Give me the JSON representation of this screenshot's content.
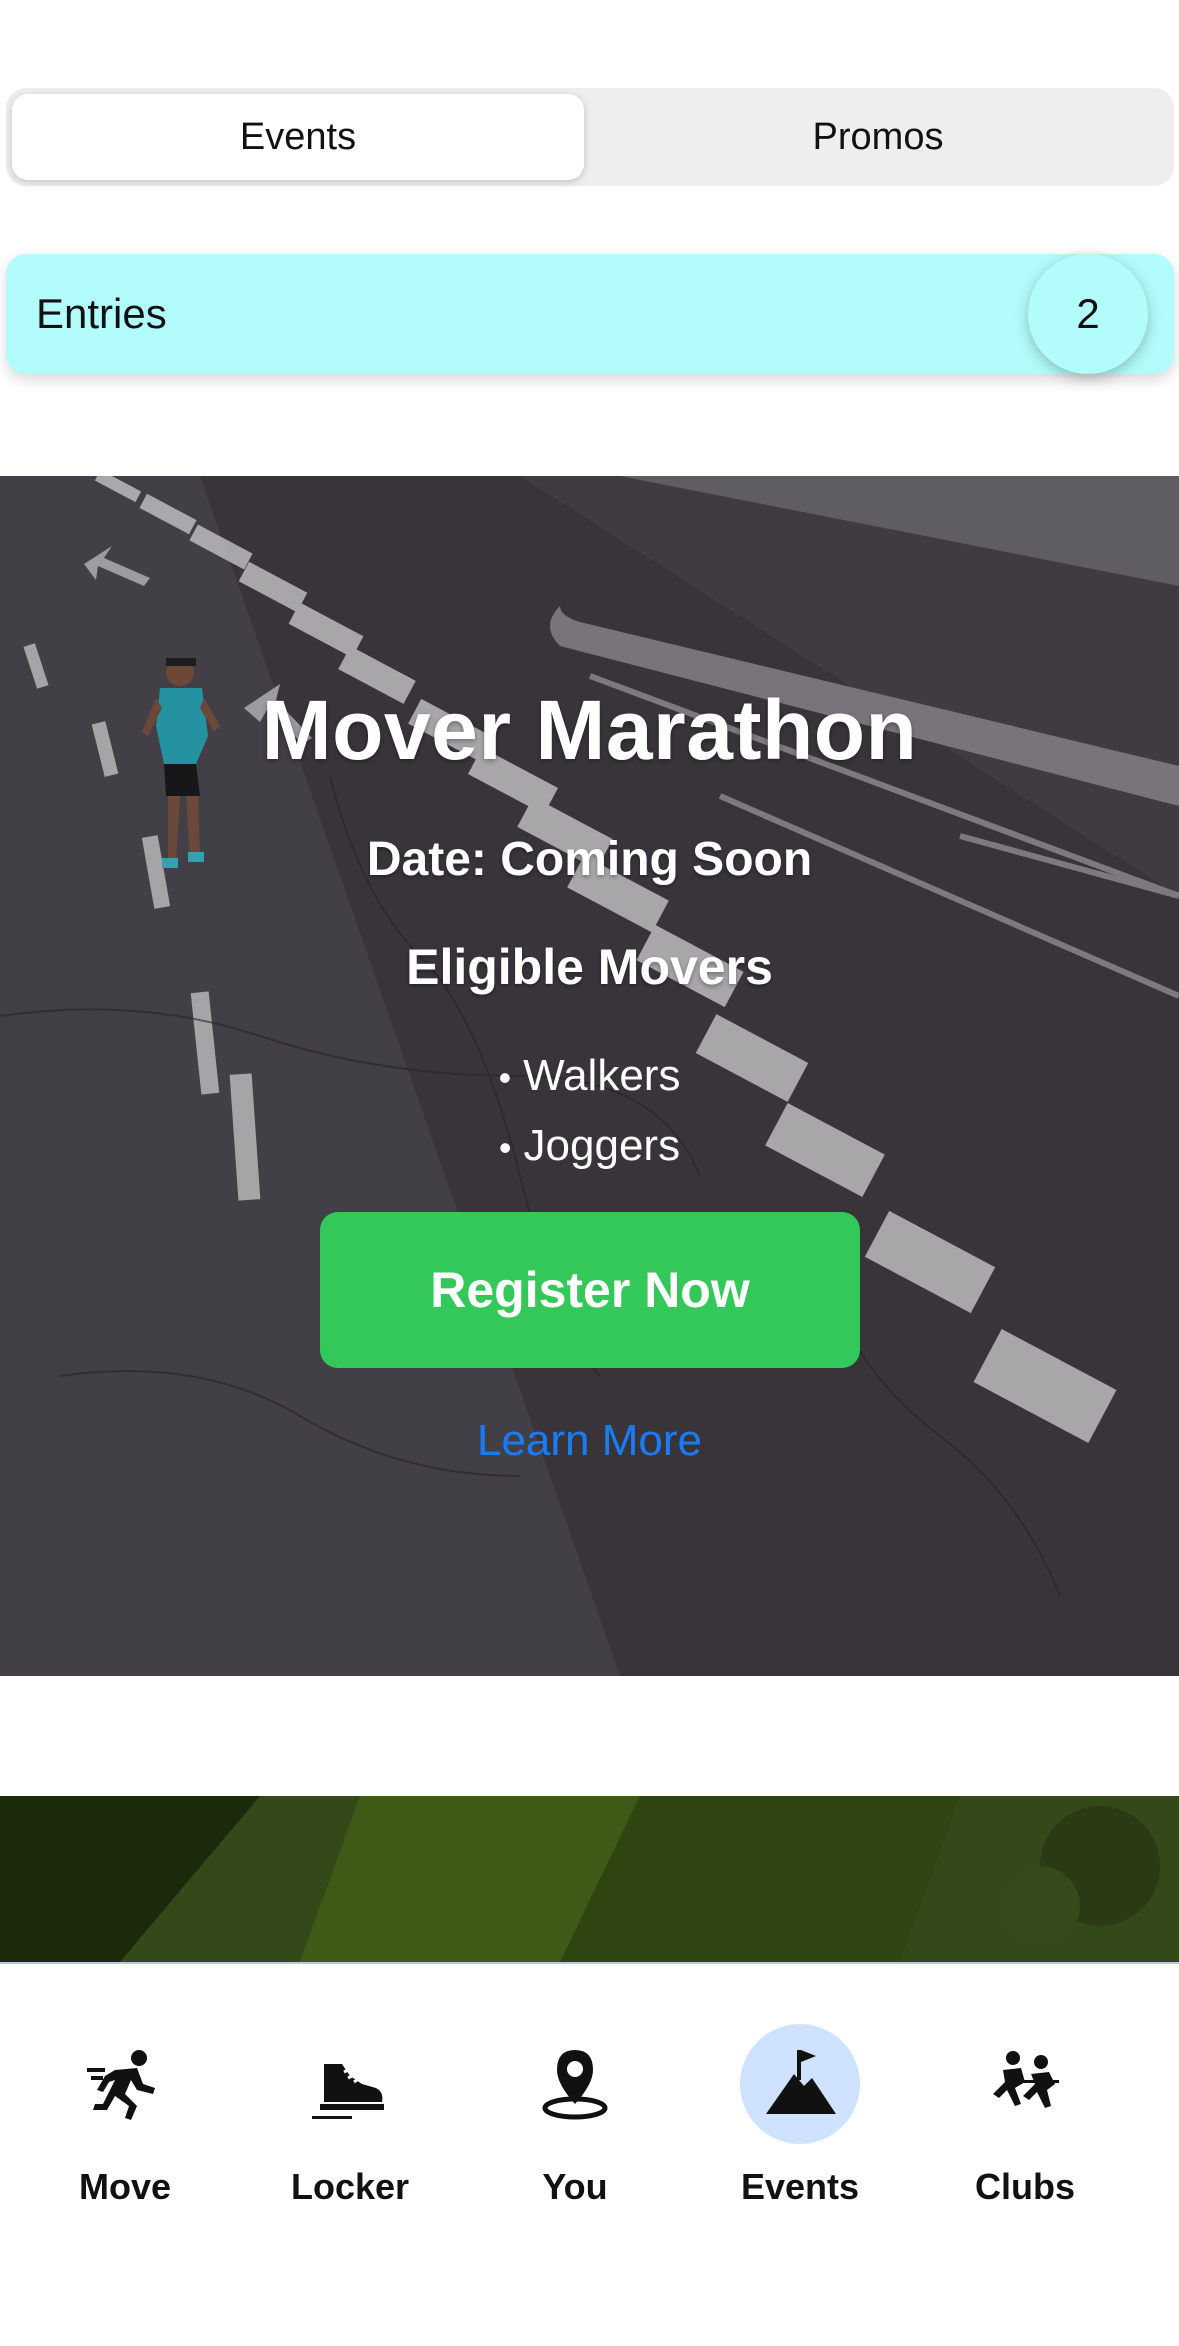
{
  "segmented": {
    "tabs": [
      {
        "label": "Events",
        "active": true
      },
      {
        "label": "Promos",
        "active": false
      }
    ]
  },
  "entries": {
    "label": "Entries",
    "count": "2"
  },
  "event": {
    "title": "Mover Marathon",
    "date": "Date: Coming Soon",
    "eligible_heading": "Eligible Movers",
    "eligible": [
      "Walkers",
      "Joggers"
    ],
    "register_label": "Register Now",
    "learn_more_label": "Learn More"
  },
  "tabbar": {
    "items": [
      {
        "label": "Move",
        "icon": "running-person-icon",
        "active": false
      },
      {
        "label": "Locker",
        "icon": "sneaker-icon",
        "active": false
      },
      {
        "label": "You",
        "icon": "location-pin-icon",
        "active": false
      },
      {
        "label": "Events",
        "icon": "mountain-flag-icon",
        "active": true
      },
      {
        "label": "Clubs",
        "icon": "group-running-icon",
        "active": false
      }
    ]
  },
  "colors": {
    "entries_bg": "#b3fcfc",
    "register_bg": "#34c759",
    "link": "#1a7cf5",
    "active_tab_bg": "#cfe2ff"
  }
}
